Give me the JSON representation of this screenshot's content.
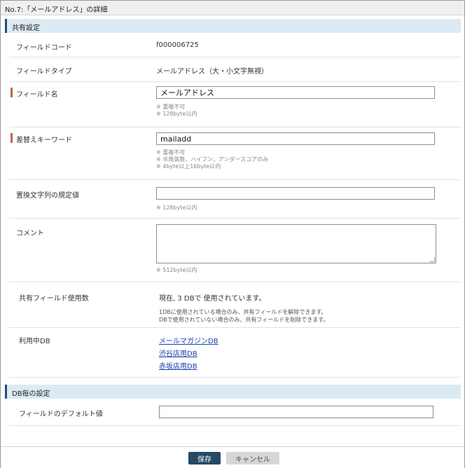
{
  "window": {
    "title": "No.7:「メールアドレス」の詳細"
  },
  "section_common": {
    "title": "共有設定"
  },
  "field_code": {
    "label": "フィールドコード",
    "value": "f000006725"
  },
  "field_type": {
    "label": "フィールドタイプ",
    "value": "メールアドレス（大・小文字無視）"
  },
  "field_name": {
    "label": "フィールド名",
    "value": "メールアドレス",
    "notes": [
      "※ 重複不可",
      "※ 128byte以内"
    ]
  },
  "keyword": {
    "label": "差替えキーワード",
    "value": "mailadd",
    "notes": [
      "※ 重複不可",
      "※ 半角英数，ハイフン，アンダースコアのみ",
      "※ 4byte以上16byte以内"
    ]
  },
  "default_replace": {
    "label": "置換文字列の規定値",
    "value": "",
    "notes": [
      "※ 128byte以内"
    ]
  },
  "comment": {
    "label": "コメント",
    "value": "",
    "notes": [
      "※ 512byte以内"
    ]
  },
  "shared_usage": {
    "label": "共有フィールド使用数",
    "value": "現在, 3 DBで 使用されています。",
    "notes": [
      "1DBに使用されている場合のみ、共有フィールドを解除できます。",
      "DBで使用されていない場合のみ、共有フィールドを削除できます。"
    ]
  },
  "used_db": {
    "label": "利用中DB",
    "links": [
      "メールマガジンDB",
      "渋谷店用DB",
      "赤坂店用DB"
    ]
  },
  "section_db": {
    "title": "DB毎の設定"
  },
  "default_value": {
    "label": "フィールドのデフォルト値",
    "value": ""
  },
  "footer": {
    "save_label": "保存",
    "cancel_label": "キャンセル"
  },
  "colors": {
    "accent": "#1f4e79",
    "section_bg": "#dcebf3",
    "required_marker": "#b86a52",
    "link": "#1a3fb0"
  }
}
